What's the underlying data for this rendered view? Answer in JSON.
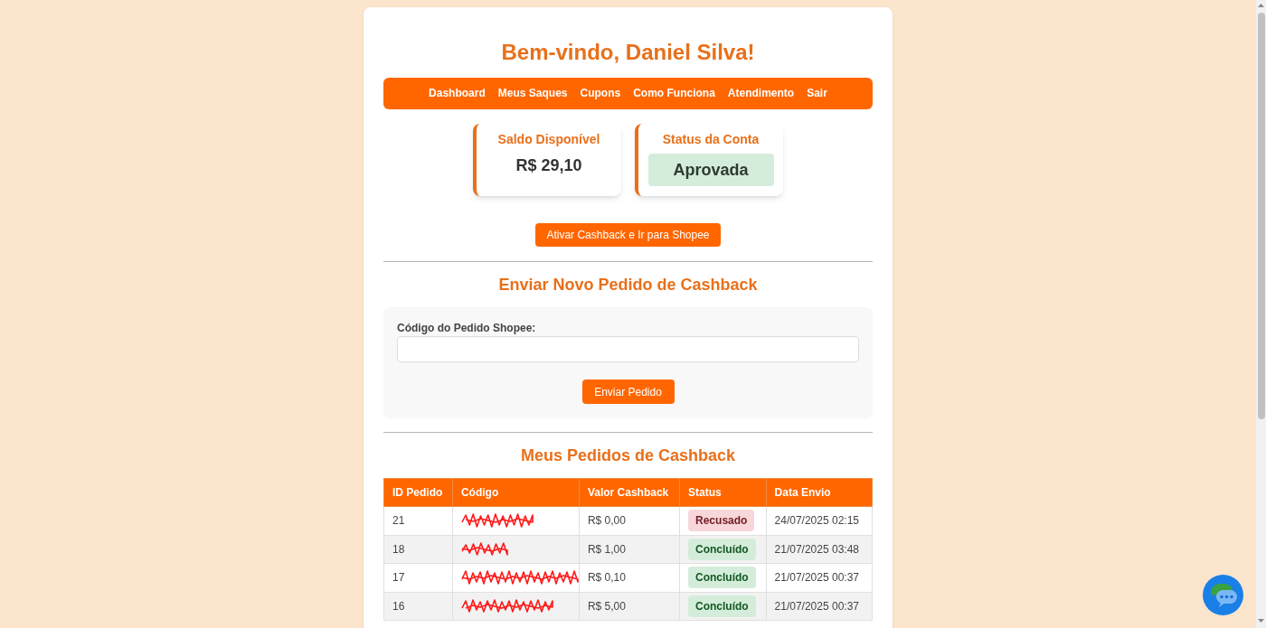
{
  "header": {
    "title": "Bem-vindo, Daniel Silva!"
  },
  "nav": [
    "Dashboard",
    "Meus Saques",
    "Cupons",
    "Como Funciona",
    "Atendimento",
    "Sair"
  ],
  "stats": [
    {
      "kind": "amount",
      "label": "Saldo Disponível",
      "value": "R$ 29,10"
    },
    {
      "kind": "badge",
      "label": "Status da Conta",
      "value": "Aprovada"
    }
  ],
  "shop_button": "Ativar Cashback e Ir para Shopee",
  "new_order": {
    "title": "Enviar Novo Pedido de Cashback",
    "field_label": "Código do Pedido Shopee:",
    "submit": "Enviar Pedido"
  },
  "orders": {
    "title": "Meus Pedidos de Cashback",
    "columns": [
      "ID Pedido",
      "Código",
      "Valor Cashback",
      "Status",
      "Data Envio"
    ],
    "rows": [
      {
        "id": "21",
        "cashback": "R$ 0,00",
        "status": {
          "label": "Recusado",
          "kind": "rejected"
        },
        "date": "24/07/2025 02:15"
      },
      {
        "id": "18",
        "cashback": "R$ 1,00",
        "status": {
          "label": "Concluído",
          "kind": "completed"
        },
        "date": "21/07/2025 03:48"
      },
      {
        "id": "17",
        "cashback": "R$ 0,10",
        "status": {
          "label": "Concluído",
          "kind": "completed"
        },
        "date": "21/07/2025 00:37"
      },
      {
        "id": "16",
        "cashback": "R$ 5,00",
        "status": {
          "label": "Concluído",
          "kind": "completed"
        },
        "date": "21/07/2025 00:37"
      }
    ]
  }
}
